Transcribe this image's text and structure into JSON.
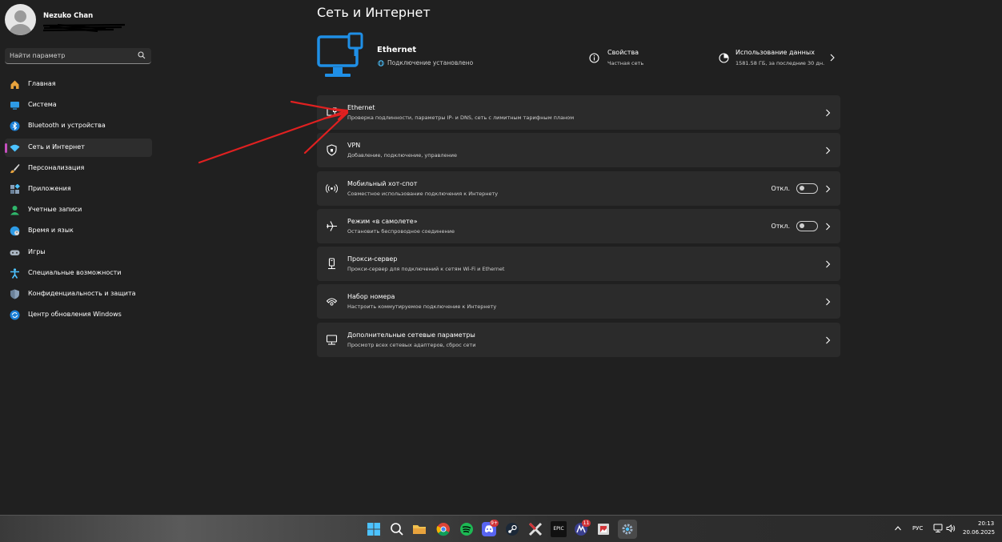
{
  "colors": {
    "accent": "#4cc2ff",
    "eth_blue": "#1f8fe6",
    "nav_indicator": "#c74fc0",
    "arrow_red": "#e02020"
  },
  "profile": {
    "name": "Nezuko Chan"
  },
  "search": {
    "placeholder": "Найти параметр"
  },
  "nav": {
    "items": [
      {
        "label": "Главная",
        "icon": "home-icon"
      },
      {
        "label": "Система",
        "icon": "monitor-icon"
      },
      {
        "label": "Bluetooth и устройства",
        "icon": "bluetooth-icon"
      },
      {
        "label": "Сеть и Интернет",
        "icon": "wifi-icon",
        "active": true
      },
      {
        "label": "Персонализация",
        "icon": "brush-icon"
      },
      {
        "label": "Приложения",
        "icon": "apps-icon"
      },
      {
        "label": "Учетные записи",
        "icon": "person-icon"
      },
      {
        "label": "Время и язык",
        "icon": "globe-icon"
      },
      {
        "label": "Игры",
        "icon": "gamepad-icon"
      },
      {
        "label": "Специальные возможности",
        "icon": "accessibility-icon"
      },
      {
        "label": "Конфиденциальность и защита",
        "icon": "shield-icon"
      },
      {
        "label": "Центр обновления Windows",
        "icon": "update-icon"
      }
    ]
  },
  "page": {
    "title": "Сеть и Интернет"
  },
  "header": {
    "name": "Ethernet",
    "status": "Подключение установлено",
    "properties_title": "Свойства",
    "properties_sub": "Частная сеть",
    "usage_title": "Использование данных",
    "usage_sub": "1581.58 ГБ, за последние 30 дн."
  },
  "rows": [
    {
      "title": "Ethernet",
      "sub": "Проверка подлинности, параметры IP- и DNS, сеть с лимитным тарифным планом",
      "icon": "ethernet-icon"
    },
    {
      "title": "VPN",
      "sub": "Добавление, подключение, управление",
      "icon": "vpn-shield-icon"
    },
    {
      "title": "Мобильный хот-спот",
      "sub": "Совместное использование подключения к Интернету",
      "icon": "hotspot-icon",
      "toggle": "Откл."
    },
    {
      "title": "Режим «в самолете»",
      "sub": "Остановить беспроводное соединение",
      "icon": "airplane-icon",
      "toggle": "Откл."
    },
    {
      "title": "Прокси-сервер",
      "sub": "Прокси-сервер для подключений к сетям Wi-Fi и Ethernet",
      "icon": "proxy-icon"
    },
    {
      "title": "Набор номера",
      "sub": "Настроить коммутируемое подключение к Интернету",
      "icon": "dialup-icon"
    },
    {
      "title": "Дополнительные сетевые параметры",
      "sub": "Просмотр всех сетевых адаптеров, сброс сети",
      "icon": "network-adapter-icon"
    }
  ],
  "taskbar": {
    "icons": [
      "windows-start-icon",
      "search-icon",
      "file-explorer-icon",
      "chrome-icon",
      "spotify-icon",
      "discord-icon",
      "steam-icon",
      "x-app-icon",
      "epic-games-icon",
      "app-icon",
      "photo-app-icon",
      "settings-icon"
    ],
    "discord_badge": "9+",
    "app_badge": "11",
    "epic_label": "EPIC",
    "language": "РУС",
    "time": "20:13",
    "date": "20.06.2025"
  }
}
